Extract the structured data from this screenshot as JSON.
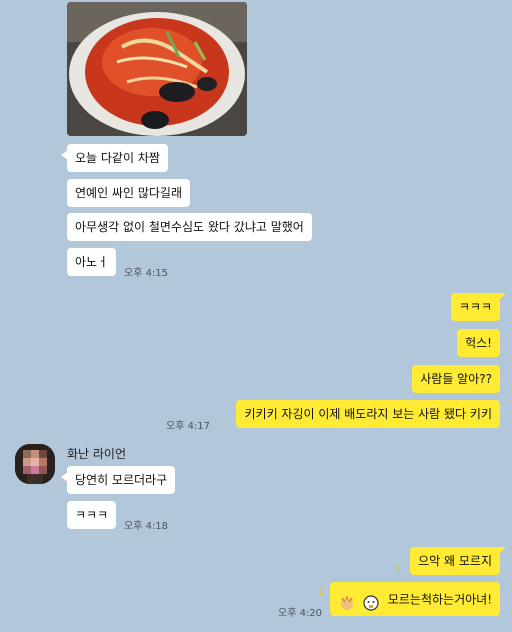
{
  "messages_in_top": [
    {
      "text": "오늘 다같이 차짬"
    },
    {
      "text": "연예인 싸인 많다길래"
    },
    {
      "text": "아무생각 없이 철면수심도 왔다 갔냐고 말했어"
    },
    {
      "text": "아노ㅓ"
    }
  ],
  "time_in_top": "오후 4:15",
  "messages_out_mid": [
    {
      "text": "ㅋㅋㅋ"
    },
    {
      "text": "헉스!"
    },
    {
      "text": "사람들 알아??"
    },
    {
      "text": "키키키 자깅이 이제 배도라지 보는 사람 됐다 키키"
    }
  ],
  "time_out_mid": "오후 4:17",
  "sender_name": "화난 라이언",
  "messages_in_bottom": [
    {
      "text": "당연히 모르더라구"
    },
    {
      "text": "ㅋㅋㅋ"
    }
  ],
  "time_in_bottom": "오후 4:18",
  "messages_out_bottom": [
    {
      "text": "으악 왜 모르지"
    },
    {
      "text": "모르는척하는거아녀!"
    }
  ],
  "unread_counts": [
    "1",
    "1"
  ],
  "time_out_bottom": "오후 4:20",
  "colors": {
    "background": "#b2c7da",
    "outgoing": "#ffeb33",
    "incoming": "#ffffff"
  }
}
